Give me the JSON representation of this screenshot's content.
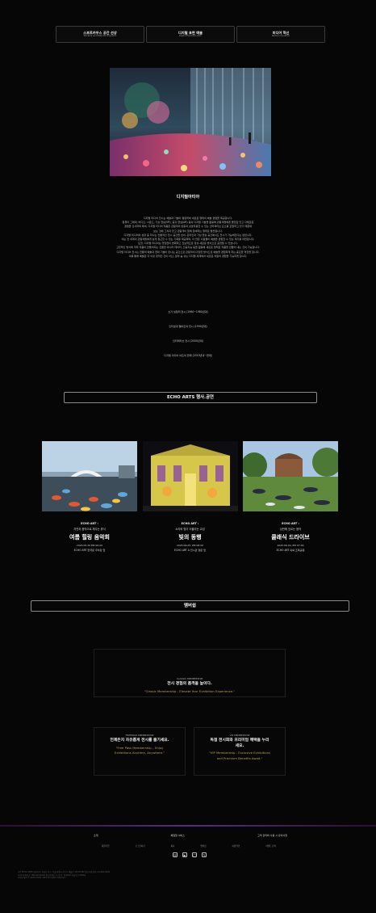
{
  "tabs": [
    {
      "title": "스프트카우스 공간 선상",
      "subtitle": "Workers and Platinite Programs"
    },
    {
      "title": "디지털 표현 예술",
      "subtitle": "Digital Expressionism"
    },
    {
      "title": "미디어 혁신",
      "subtitle": "Media Innovation"
    }
  ],
  "intro": {
    "title": "디지털아티아",
    "paragraphs": [
      "디지털 미디어 전시는 예술과 기술이 결합하여 새로운 형태의 예술 경험을 제공합니다.",
      "컴퓨터 그래픽, 비디오, 사운드, 가상 현실(VR), 증강 현실(AR) 등의 디지털 기술을 활용해 관람객들에게 몰입감 있고 다채로운",
      "경험을 선사하며 특히, 디지털 미디어 작품은 관람객의 반응과 상호작용할 수 있는 인터랙티브 요소를 포함하고 있기 때문에",
      "보는 것에 그치지 않고 관람객이 함께 참여하는 형태로 발전합니다.",
      "디지털 미디어의 성장 중 하나는 전통적인 전시 공간을 넘어, 온라인과 가상 현실 공간에서도 전시가 가능해진다는 점입니다.",
      "이는 전 세계의 관람객들에게 쉽게 접근할 수 있는 기회를 제공하며, 더 많은 사람들이 예술을 경험할 수 있는 계기를 마련합니다.",
      "또한, 디지털 미디어는 끊임없이 변화하고 진보하므로 항상 새로운 방식으로 표현될 수 있습니다.",
      "고전적인 방식에 따라 작품이 만들어지는 것뿐만 아니라 데이터, 인공지능 등을 활용해 새로운 형태로 작품을 만들어 내는 것이 가능합니다.",
      "디지털 미디어 전시는 전통적 예술과 현대 기술이 만나는 공간으로 관람객이 다양한 방식으로 예술을 경험하게 하는 중요한 역할을 합니다.",
      "이를 통해 예술은 더 이상 정적인 것이 아닌, 살아 숨 쉬는 디지털 세계에서 새로운 차원의 경험을 가능하게 합니다."
    ],
    "timeline": [
      "초기 실험적 전시 (1960~1980년대)",
      "인터넷과 웹아트의 전시 (1990년대)",
      "인터랙티브 전시 (2000년대)",
      "디지털 미디어 아트의 현재 (2010년대~현재)"
    ]
  },
  "events_section": {
    "title": "ECHO ARTS 행사.공연",
    "events": [
      {
        "brand": "ECHO ART :",
        "sub": "자연과 음악으로 채우는 휴식",
        "name": "여름 힐링 음악회",
        "date": "2025.05.20 PM 06:00",
        "place": "ECHO ART 한국문 주차장 앞"
      },
      {
        "brand": "ECHO ART :",
        "sub": "소리와 빛이 어울리는 교감",
        "name": "빛의 동행",
        "date": "2025.06.05. PM 08:00",
        "place": "ECHO ART A 전시관 정문 앞"
      },
      {
        "brand": "ECHO ART :",
        "sub": "낭만에 흐르는 음악",
        "name": "클래식 드라이브",
        "date": "2025.06.04. PM 07:00",
        "place": "ECHO ART 야외 조폭공원"
      }
    ]
  },
  "membership": {
    "title": "멤버쉽",
    "cards": [
      {
        "kicker": "CLASSIC MEMBERSHIP",
        "head": "전시 경험의 품격을 높이다.",
        "quote": "\"Classic Membership - Elevate Your Exhibition Experience.\""
      },
      {
        "kicker": "FREEPASS MEMBERSHIP",
        "head": "언제든지 자유롭게 전시를 즐기세요.",
        "quote": "\"Free Pass Membership – Enjoy Exhibitions Anytime, Anywhere.\""
      },
      {
        "kicker": "VIP MEMBERSHIP",
        "head": "독점 전시회와 프리미엄 혜택을 누리세요.",
        "quote": "\"VIP Membership - Exclusive Exhibitions and Premium Benefits Await.\""
      }
    ]
  },
  "footer": {
    "nav": [
      "소개",
      "체험형 서비스",
      "고객 관리와 사용 시 유의사항"
    ],
    "links": [
      "회원가입",
      "로그인하기",
      "회사",
      "멤버십",
      "이용약관",
      "이벤트 문의"
    ],
    "icons": [
      "chat-icon",
      "play-icon",
      "instagram-icon",
      "blog-icon"
    ],
    "legal": [
      "(주) ECHO ARTS 대표이사: 홍길동 주소: 서울 특별시 종로구 예술로 123 ECHO 빌딩 대표전화: 02-000-0000",
      "사업자등록번호: 000-00-00000 통신판매업 신고번호: 제 0000-서울종로-0000호",
      "Copyright © 2025 ECHO ARTS All rights reserved."
    ]
  }
}
